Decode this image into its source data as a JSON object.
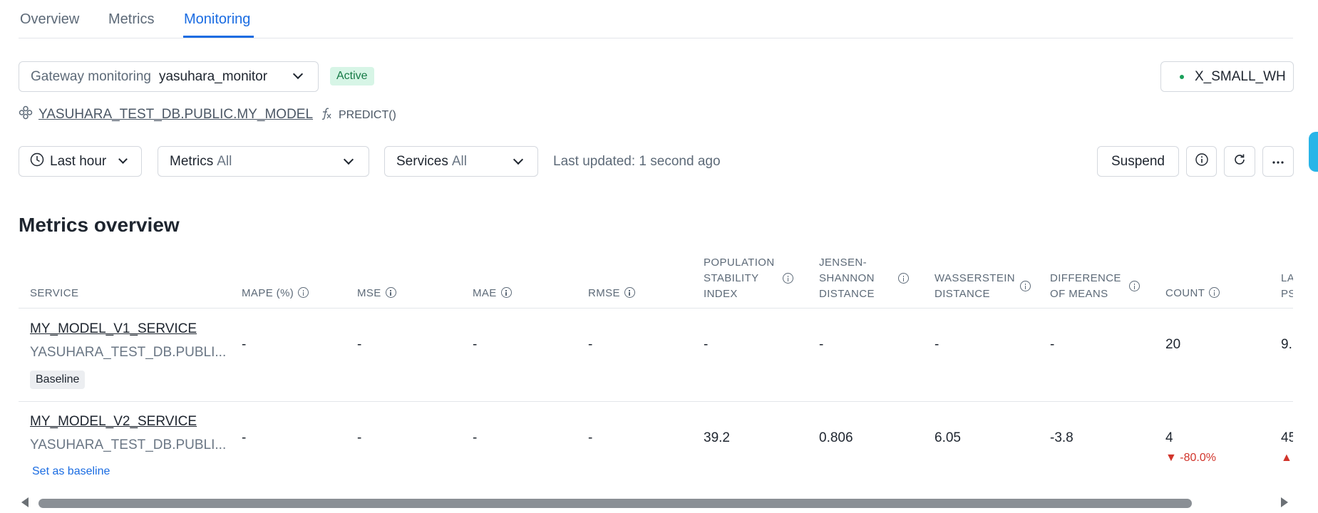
{
  "tabs": [
    {
      "label": "Overview"
    },
    {
      "label": "Metrics"
    },
    {
      "label": "Monitoring"
    }
  ],
  "active_tab": "Monitoring",
  "monitor": {
    "label": "Gateway monitoring",
    "value": "yasuhara_monitor",
    "status": "Active"
  },
  "warehouse": {
    "name": "X_SMALL_WH",
    "status_color": "#1aa05a"
  },
  "model": {
    "path": "YASUHARA_TEST_DB.PUBLIC.MY_MODEL",
    "function": "PREDICT()"
  },
  "filters": {
    "time_range": "Last hour",
    "metrics_label": "Metrics",
    "metrics_value": "All",
    "services_label": "Services",
    "services_value": "All",
    "last_updated": "Last updated: 1 second ago"
  },
  "actions": {
    "suspend": "Suspend"
  },
  "section_title": "Metrics overview",
  "table": {
    "headers": {
      "service": "SERVICE",
      "mape": "MAPE (%)",
      "mse": "MSE",
      "mae": "MAE",
      "rmse": "RMSE",
      "psi_1": "POPULATION",
      "psi_2": "STABILITY",
      "psi_3": "INDEX",
      "js_1": "JENSEN-",
      "js_2": "SHANNON",
      "js_3": "DISTANCE",
      "ws_1": "WASSERSTEIN",
      "ws_2": "DISTANCE",
      "dom_1": "DIFFERENCE",
      "dom_2": "OF MEANS",
      "count": "COUNT",
      "last_1": "LA",
      "last_2": "PS"
    },
    "rows": [
      {
        "name": "MY_MODEL_V1_SERVICE",
        "path": "YASUHARA_TEST_DB.PUBLI...",
        "tag": "Baseline",
        "mape": "-",
        "mse": "-",
        "mae": "-",
        "rmse": "-",
        "psi": "-",
        "js": "-",
        "ws": "-",
        "dom": "-",
        "count": "20",
        "last": "9."
      },
      {
        "name": "MY_MODEL_V2_SERVICE",
        "path": "YASUHARA_TEST_DB.PUBLI...",
        "action": "Set as baseline",
        "mape": "-",
        "mse": "-",
        "mae": "-",
        "rmse": "-",
        "psi": "39.2",
        "js": "0.806",
        "ws": "6.05",
        "dom": "-3.8",
        "count": "4",
        "count_delta": "▼ -80.0%",
        "last": "45",
        "last_delta": "▲"
      }
    ]
  },
  "colors": {
    "accent": "#1a6ce2",
    "active_badge_bg": "#d7f5e6",
    "active_badge_text": "#157a45",
    "negative": "#d1342b"
  }
}
